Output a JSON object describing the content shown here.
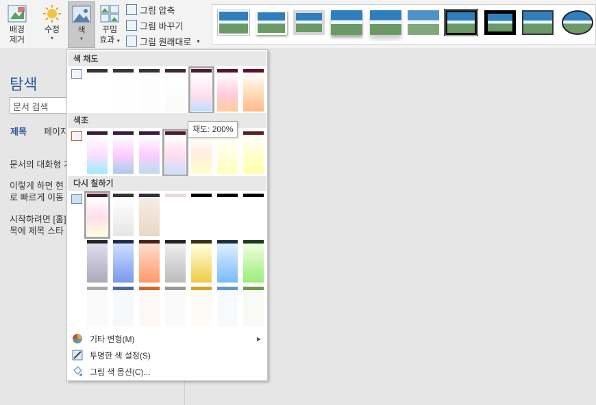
{
  "ribbon": {
    "remove_bg": {
      "label1": "배경",
      "label2": "제거"
    },
    "correct": {
      "label": "수정"
    },
    "color": {
      "label": "색"
    },
    "effects": {
      "label1": "꾸밈",
      "label2": "효과"
    },
    "compress": "그림 압축",
    "change": "그림 바꾸기",
    "reset": "그림 원래대로"
  },
  "nav": {
    "title": "탐색",
    "search_placeholder": "문서 검색",
    "tab_headings": "제목",
    "tab_pages": "페이지",
    "line1": "문서의 대화형 개",
    "line2": "이렇게 하면 현",
    "line3": "로 빠르게 이동",
    "line4": "시작하려면 [홈]",
    "line5": "목에 제목 스타"
  },
  "menu": {
    "saturation_header": "색 채도",
    "tone_header": "색조",
    "recolor_header": "다시 칠하기",
    "more_variations": "기타 변형(M)",
    "set_transparent": "투명한 색 설정(S)",
    "color_options": "그림 색 옵션(C)..."
  },
  "tooltip": "채도: 200%",
  "colors": {
    "accent": "#2b579a",
    "ribbon_bg": "#f3f3f3",
    "menu_header": "#e8e8e8",
    "selected_outline": "#a5a5a5"
  }
}
